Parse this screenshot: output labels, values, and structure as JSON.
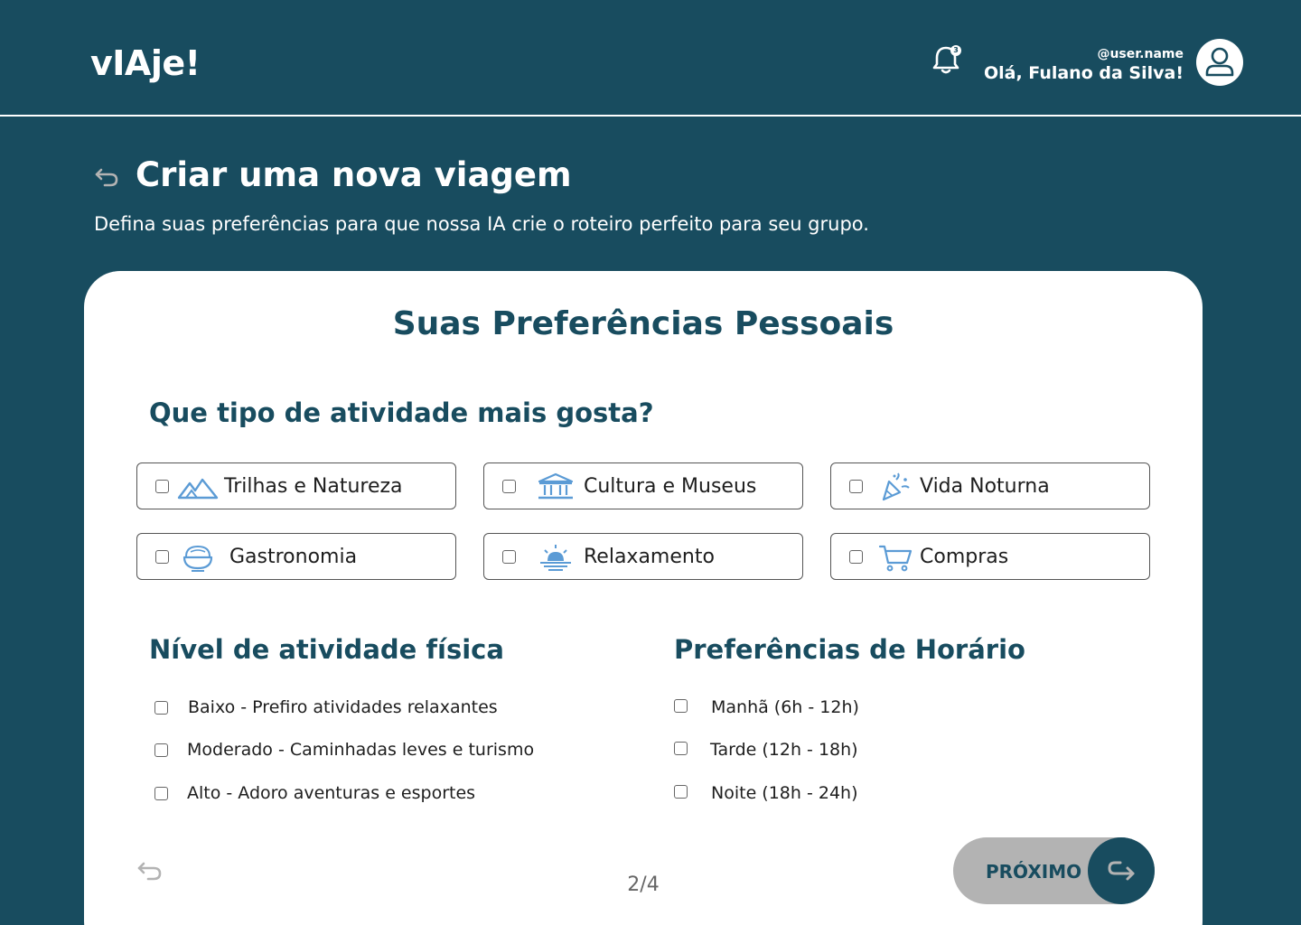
{
  "app": {
    "logo": "vIAje!"
  },
  "header": {
    "notifications_count": "3",
    "user_handle": "@user.name",
    "greeting": "Olá, Fulano da Silva!"
  },
  "page": {
    "title": "Criar uma nova viagem",
    "subtitle": "Defina suas preferências para que nossa IA crie o roteiro perfeito para seu grupo."
  },
  "card": {
    "title": "Suas Preferências Pessoais",
    "activity_question": "Que tipo de atividade mais gosta?",
    "activities": [
      {
        "label": "Trilhas e Natureza",
        "icon": "mountain-icon",
        "checked": false
      },
      {
        "label": "Cultura e Museus",
        "icon": "museum-icon",
        "checked": false
      },
      {
        "label": "Vida Noturna",
        "icon": "party-popper-icon",
        "checked": false
      },
      {
        "label": "Gastronomia",
        "icon": "food-bowl-icon",
        "checked": false
      },
      {
        "label": "Relaxamento",
        "icon": "sunset-icon",
        "checked": false
      },
      {
        "label": "Compras",
        "icon": "shopping-cart-icon",
        "checked": false
      }
    ],
    "physical_title": "Nível de atividade física",
    "physical_levels": [
      {
        "label": "Baixo - Prefiro atividades relaxantes",
        "checked": false
      },
      {
        "label": "Moderado - Caminhadas leves e turismo",
        "checked": false
      },
      {
        "label": "Alto - Adoro aventuras e esportes",
        "checked": false
      }
    ],
    "schedule_title": "Preferências de Horário",
    "schedules": [
      {
        "label": "Manhã (6h - 12h)",
        "checked": false
      },
      {
        "label": "Tarde (12h - 18h)",
        "checked": false
      },
      {
        "label": "Noite (18h - 24h)",
        "checked": false
      }
    ],
    "pager": "2/4",
    "next_label": "PRÓXIMO"
  },
  "colors": {
    "primary": "#184c5f",
    "icon_blue": "#5b9bd5",
    "button_gray": "#b3b3b3",
    "background": "#ffffff"
  }
}
